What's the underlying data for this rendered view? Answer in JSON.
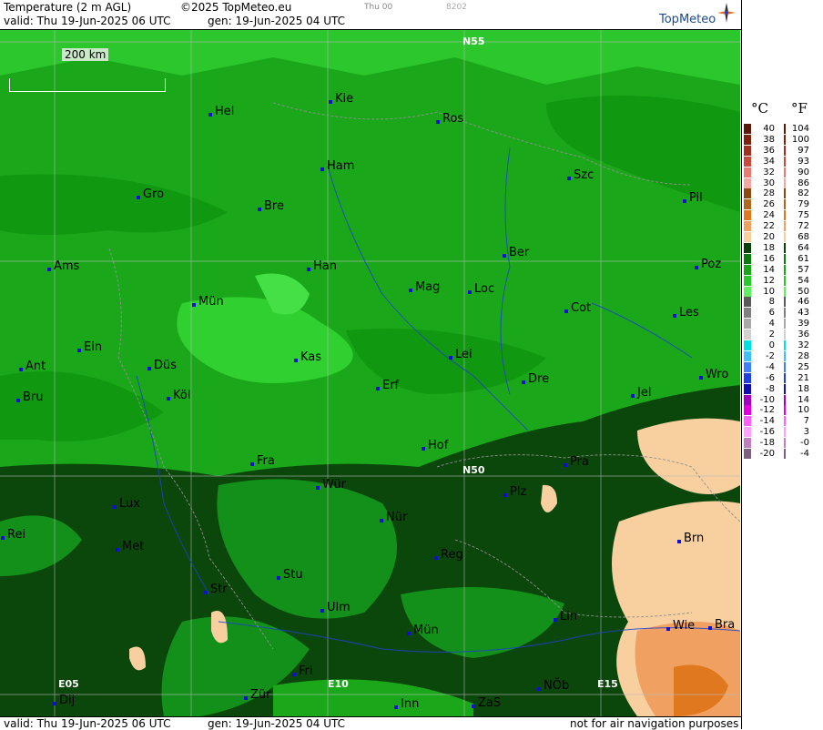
{
  "header": {
    "product": "Temperature (2 m AGL)",
    "copyright": "©2025 TopMeteo.eu",
    "run_label": "Thu 00",
    "code": "8202",
    "valid": "valid:  Thu  19-Jun-2025  06 UTC",
    "gen": "gen: 19-Jun-2025 04 UTC",
    "logo": "TopMeteo"
  },
  "footer": {
    "valid": "valid:  Thu  19-Jun-2025  06 UTC",
    "gen": "gen: 19-Jun-2025 04 UTC",
    "notice": "not for air navigation purposes"
  },
  "scale_bar": {
    "label": "200 km"
  },
  "coords": [
    "N55",
    "N50",
    "E05",
    "E10",
    "E15"
  ],
  "cities": [
    "Kie",
    "Hel",
    "Ros",
    "Ham",
    "Szc",
    "Gro",
    "Bre",
    "Pil",
    "Ams",
    "Han",
    "Ber",
    "Poz",
    "Mün",
    "Mag",
    "Loc",
    "Cot",
    "Les",
    "Ein",
    "Kas",
    "Lei",
    "Ant",
    "Düs",
    "Dre",
    "Wro",
    "Bru",
    "Köl",
    "Erf",
    "Jel",
    "Hof",
    "Fra",
    "Pra",
    "Würz",
    "Plz",
    "Lux",
    "Nür",
    "Rei",
    "Met",
    "Reg",
    "Brn",
    "Stu",
    "Str",
    "Ulm",
    "Lin",
    "Wie",
    "Bra",
    "Mün2",
    "Fri",
    "NÖb",
    "Dij",
    "Zür",
    "Inn",
    "ZaS"
  ],
  "city_labels": {
    "Kie": "Kie",
    "Hel": "Hel",
    "Ros": "Ros",
    "Ham": "Ham",
    "Szc": "Szc",
    "Gro": "Gro",
    "Bre": "Bre",
    "Pil": "Pil",
    "Ams": "Ams",
    "Han": "Han",
    "Ber": "Ber",
    "Poz": "Poz",
    "Mün": "Mün",
    "Mag": "Mag",
    "Loc": "Loc",
    "Cot": "Cot",
    "Les": "Les",
    "Ein": "Ein",
    "Kas": "Kas",
    "Lei": "Lei",
    "Ant": "Ant",
    "Düs": "Düs",
    "Dre": "Dre",
    "Wro": "Wro",
    "Bru": "Bru",
    "Köl": "Köl",
    "Erf": "Erf",
    "Jel": "Jel",
    "Hof": "Hof",
    "Fra": "Fra",
    "Pra": "Pra",
    "Würz": "Wür",
    "Plz": "Plz",
    "Lux": "Lux",
    "Nür": "Nür",
    "Rei": "Rei",
    "Met": "Met",
    "Reg": "Reg",
    "Brn": "Brn",
    "Stu": "Stu",
    "Str": "Str",
    "Ulm": "Ulm",
    "Lin": "Lin",
    "Wie": "Wie",
    "Bra": "Bra",
    "Mün2": "Mün",
    "Fri": "Fri",
    "NÖb": "NÖb",
    "Dij": "Dij",
    "Zür": "Zür",
    "Inn": "Inn",
    "ZaS": "ZaS"
  },
  "legend": {
    "unit_c": "°C",
    "unit_f": "°F",
    "rows": [
      {
        "c": "40",
        "f": "104",
        "color": "#5a1a0a"
      },
      {
        "c": "38",
        "f": "100",
        "color": "#7a2410"
      },
      {
        "c": "36",
        "f": "97",
        "color": "#a03020"
      },
      {
        "c": "34",
        "f": "93",
        "color": "#c84a3a"
      },
      {
        "c": "32",
        "f": "90",
        "color": "#e87a70"
      },
      {
        "c": "30",
        "f": "86",
        "color": "#f0a8a0"
      },
      {
        "c": "28",
        "f": "82",
        "color": "#8a4a10"
      },
      {
        "c": "26",
        "f": "79",
        "color": "#b06820"
      },
      {
        "c": "24",
        "f": "75",
        "color": "#e07820"
      },
      {
        "c": "22",
        "f": "72",
        "color": "#f0a060"
      },
      {
        "c": "20",
        "f": "68",
        "color": "#f8d0a0"
      },
      {
        "c": "18",
        "f": "64",
        "color": "#0a400a"
      },
      {
        "c": "16",
        "f": "61",
        "color": "#0d7a0d"
      },
      {
        "c": "14",
        "f": "57",
        "color": "#19a619"
      },
      {
        "c": "12",
        "f": "54",
        "color": "#2ac82a"
      },
      {
        "c": "10",
        "f": "50",
        "color": "#5ef05e"
      },
      {
        "c": "8",
        "f": "46",
        "color": "#5a5a5a"
      },
      {
        "c": "6",
        "f": "43",
        "color": "#808080"
      },
      {
        "c": "4",
        "f": "39",
        "color": "#a8a8a8"
      },
      {
        "c": "2",
        "f": "36",
        "color": "#d0d0d0"
      },
      {
        "c": "0",
        "f": "32",
        "color": "#00e0e0"
      },
      {
        "c": "-2",
        "f": "28",
        "color": "#40c0ff"
      },
      {
        "c": "-4",
        "f": "25",
        "color": "#4080ff"
      },
      {
        "c": "-6",
        "f": "21",
        "color": "#2040e0"
      },
      {
        "c": "-8",
        "f": "18",
        "color": "#1010b0"
      },
      {
        "c": "-10",
        "f": "14",
        "color": "#a000c0"
      },
      {
        "c": "-12",
        "f": "10",
        "color": "#e000e0"
      },
      {
        "c": "-14",
        "f": "7",
        "color": "#ff60ff"
      },
      {
        "c": "-16",
        "f": "3",
        "color": "#ffa0ff"
      },
      {
        "c": "-18",
        "f": "-0",
        "color": "#c080c0"
      },
      {
        "c": "-20",
        "f": "-4",
        "color": "#806080"
      }
    ]
  }
}
